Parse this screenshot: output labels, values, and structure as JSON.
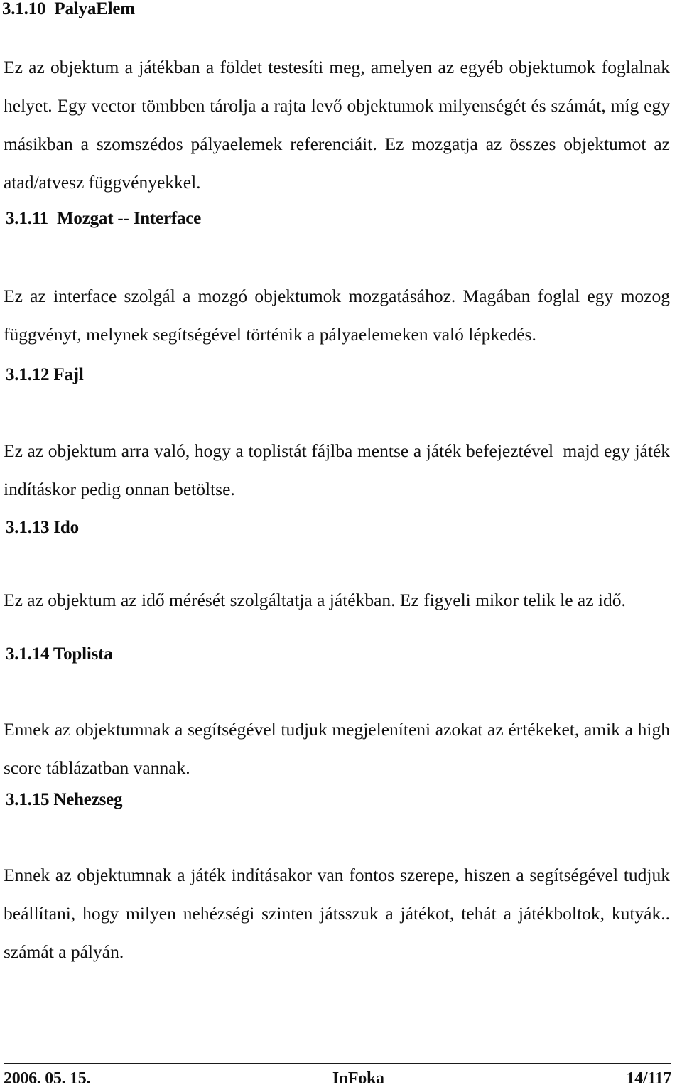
{
  "document": {
    "language": "hu",
    "page_background": "#ffffff",
    "text_color": "#111111"
  },
  "sections": [
    {
      "id": "3.1.10",
      "heading": "3.1.10  PalyaElem",
      "body": "Ez az objektum a játékban a földet testesíti meg, amelyen az egyéb objektumok foglalnak helyet. Egy vector tömbben tárolja a rajta levő objektumok milyenségét és számát, míg egy másikban a szomszédos pályaelemek referenciáit. Ez mozgatja az összes objektumot az atad/atvesz függvényekkel."
    },
    {
      "id": "3.1.11",
      "heading": "3.1.11  Mozgat -- Interface",
      "body": "Ez az interface szolgál a mozgó objektumok mozgatásához. Magában foglal egy mozog függvényt, melynek segítségével történik a pályaelemeken való lépkedés."
    },
    {
      "id": "3.1.12",
      "heading": "3.1.12 Fajl",
      "body": "Ez az objektum arra való, hogy a toplistát fájlba mentse a játék befejeztével  majd egy játék indításkor pedig onnan betöltse."
    },
    {
      "id": "3.1.13",
      "heading": "3.1.13 Ido",
      "body": "Ez az objektum az idő mérését szolgáltatja a játékban. Ez figyeli mikor telik le az idő."
    },
    {
      "id": "3.1.14",
      "heading": "3.1.14 Toplista",
      "body": "Ennek az objektumnak a segítségével tudjuk megjeleníteni azokat az értékeket, amik a high score táblázatban vannak."
    },
    {
      "id": "3.1.15",
      "heading": "3.1.15 Nehezseg",
      "body": "Ennek az objektumnak a játék indításakor van fontos szerepe, hiszen a segítségével tudjuk beállítani, hogy milyen nehézségi szinten játsszuk a játékot, tehát a játékboltok, kutyák.. számát a pályán."
    }
  ],
  "footer": {
    "date": "2006. 05. 15.",
    "organization": "InFoka",
    "page_number": "14/117"
  }
}
